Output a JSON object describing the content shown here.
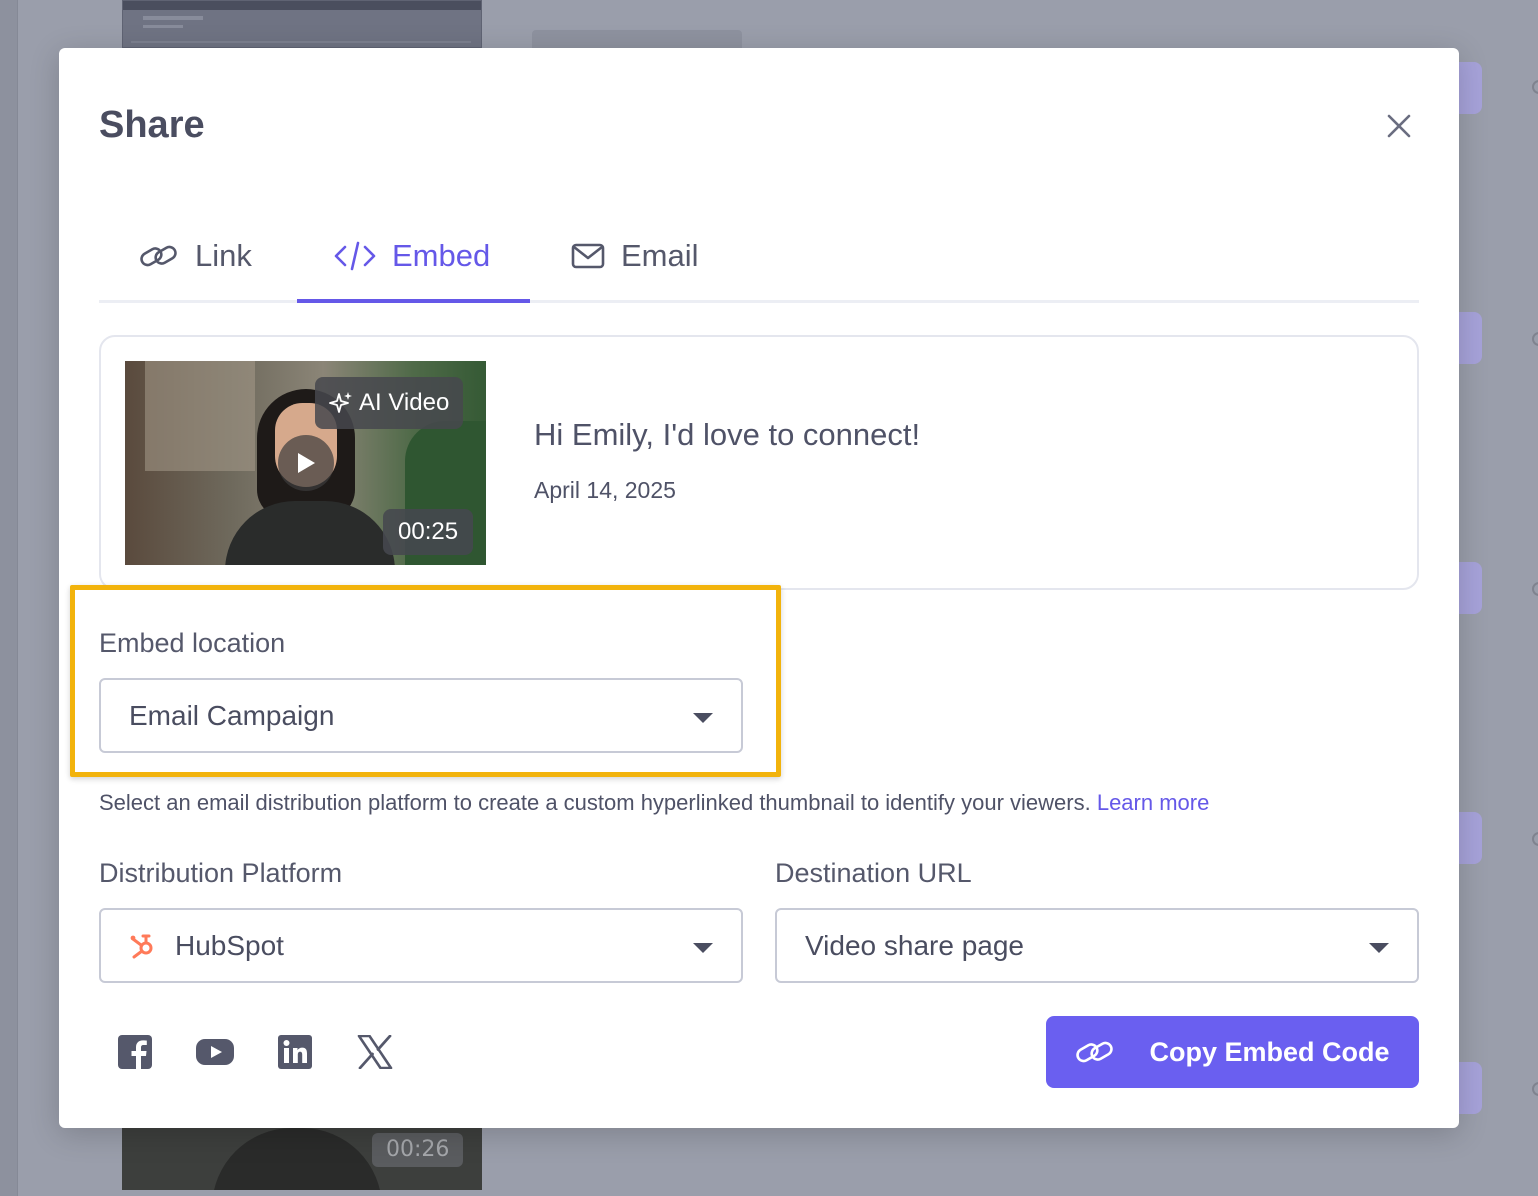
{
  "modal": {
    "title": "Share"
  },
  "tabs": [
    {
      "label": "Link",
      "icon": "link-icon",
      "active": false
    },
    {
      "label": "Embed",
      "icon": "code-icon",
      "active": true
    },
    {
      "label": "Email",
      "icon": "envelope-icon",
      "active": false
    }
  ],
  "video": {
    "badge": "AI Video",
    "duration": "00:25",
    "title": "Hi Emily, I'd love to connect!",
    "date": "April 14, 2025"
  },
  "embed_location": {
    "label": "Embed location",
    "selected": "Email Campaign"
  },
  "help": {
    "text": "Select an email distribution platform to create a custom hyperlinked thumbnail to identify your viewers.",
    "link": "Learn more"
  },
  "distribution": {
    "label": "Distribution Platform",
    "selected": "HubSpot",
    "icon": "hubspot-icon"
  },
  "destination": {
    "label": "Destination URL",
    "selected": "Video share page"
  },
  "social": [
    "facebook-icon",
    "youtube-icon",
    "linkedin-icon",
    "x-icon"
  ],
  "copy_button": {
    "label": "Copy Embed Code"
  },
  "background": {
    "duration": "00:26"
  },
  "colors": {
    "accent": "#6558e8",
    "highlight": "#f2b30c",
    "hubspot": "#ff7a59"
  }
}
